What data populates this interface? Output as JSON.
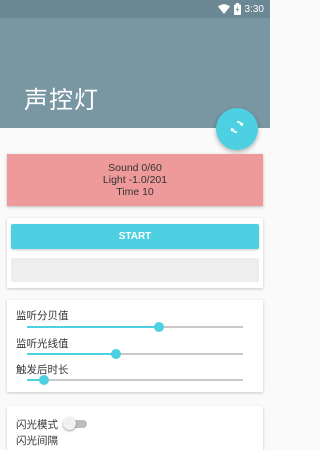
{
  "status_bar": {
    "time": "3:30",
    "icons": [
      "wifi-icon",
      "battery-charging-icon"
    ]
  },
  "app_bar": {
    "title": "声控灯"
  },
  "fab": {
    "icon": "refresh-icon"
  },
  "info": {
    "sound": "Sound 0/60",
    "light": "Light -1.0/201",
    "time": "Time 10"
  },
  "buttons": {
    "start_label": "START"
  },
  "sliders": [
    {
      "label": "监听分贝值",
      "value": 0.61
    },
    {
      "label": "监听光线值",
      "value": 0.41
    },
    {
      "label": "触发后时长",
      "value": 0.08
    }
  ],
  "flash": {
    "mode_label": "闪光模式",
    "mode_enabled": false,
    "interval_label": "闪光间隔"
  },
  "colors": {
    "primary": "#7996a3",
    "status_bar": "#6b8794",
    "accent": "#4dd0e1",
    "info_card": "#ef9a9a"
  }
}
